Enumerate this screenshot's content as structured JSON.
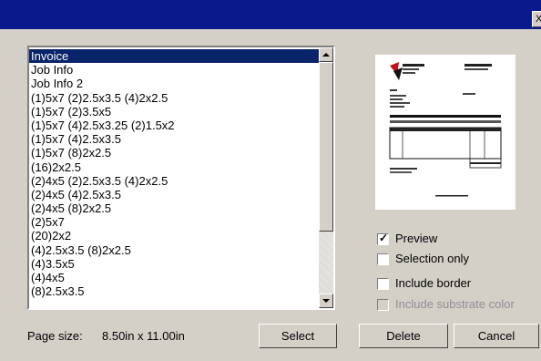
{
  "window": {
    "close_glyph": "X"
  },
  "list": {
    "items": [
      "Invoice",
      "Job Info",
      "Job Info 2",
      "(1)5x7 (2)2.5x3.5 (4)2x2.5",
      "(1)5x7 (2)3.5x5",
      "(1)5x7 (4)2.5x3.25 (2)1.5x2",
      "(1)5x7 (4)2.5x3.5",
      "(1)5x7 (8)2x2.5",
      "(16)2x2.5",
      "(2)4x5 (2)2.5x3.5 (4)2x2.5",
      "(2)4x5 (4)2.5x3.5",
      "(2)4x5 (8)2x2.5",
      "(2)5x7",
      "(20)2x2",
      "(4)2.5x3.5 (8)2x2.5",
      "(4)3.5x5",
      "(4)4x5",
      "(8)2.5x3.5"
    ],
    "selected_index": 0
  },
  "options": {
    "preview": {
      "label": "Preview",
      "checked": true,
      "enabled": true
    },
    "selection_only": {
      "label": "Selection only",
      "checked": false,
      "enabled": true
    },
    "include_border": {
      "label": "Include border",
      "checked": false,
      "enabled": true
    },
    "include_substrate": {
      "label": "Include substrate color",
      "checked": false,
      "enabled": false
    }
  },
  "footer": {
    "page_size_label": "Page size:",
    "page_size_value": "8.50in x 11.00in",
    "select_label": "Select",
    "delete_label": "Delete",
    "cancel_label": "Cancel"
  },
  "colors": {
    "title_bar": "#0a1a8c",
    "selection": "#0a246a",
    "face": "#d4d0c8"
  }
}
